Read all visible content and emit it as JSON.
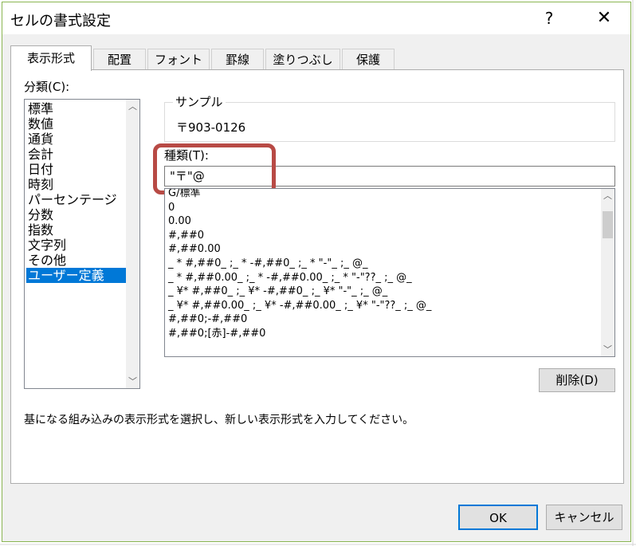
{
  "window": {
    "title": "セルの書式設定",
    "help_label": "?",
    "close_label": "✕"
  },
  "tabs": [
    {
      "label": "表示形式",
      "active": true
    },
    {
      "label": "配置",
      "active": false
    },
    {
      "label": "フォント",
      "active": false
    },
    {
      "label": "罫線",
      "active": false
    },
    {
      "label": "塗りつぶし",
      "active": false
    },
    {
      "label": "保護",
      "active": false
    }
  ],
  "category": {
    "label": "分類(C):",
    "items": [
      "標準",
      "数値",
      "通貨",
      "会計",
      "日付",
      "時刻",
      "パーセンテージ",
      "分数",
      "指数",
      "文字列",
      "その他",
      "ユーザー定義"
    ],
    "selected": "ユーザー定義"
  },
  "sample": {
    "label": "サンプル",
    "value": "〒903-0126"
  },
  "type": {
    "label": "種類(T):",
    "value": "\"〒\"@",
    "formats": [
      "G/標準",
      "0",
      "0.00",
      "#,##0",
      "#,##0.00",
      "_ * #,##0_ ;_ * -#,##0_ ;_ * \"-\"_ ;_ @_",
      "_ * #,##0.00_ ;_ * -#,##0.00_ ;_ * \"-\"??_ ;_ @_",
      "_ ¥* #,##0_ ;_ ¥* -#,##0_ ;_ ¥* \"-\"_ ;_ @_",
      "_ ¥* #,##0.00_ ;_ ¥* -#,##0.00_ ;_ ¥* \"-\"??_ ;_ @_",
      "#,##0;-#,##0",
      "#,##0;[赤]-#,##0"
    ]
  },
  "buttons": {
    "delete": "削除(D)",
    "ok": "OK",
    "cancel": "キャンセル"
  },
  "description": "基になる組み込みの表示形式を選択し、新しい表示形式を入力してください。",
  "colors": {
    "selection": "#0078d7",
    "highlight": "#b84a45",
    "dialog_border": "#8ab552"
  }
}
